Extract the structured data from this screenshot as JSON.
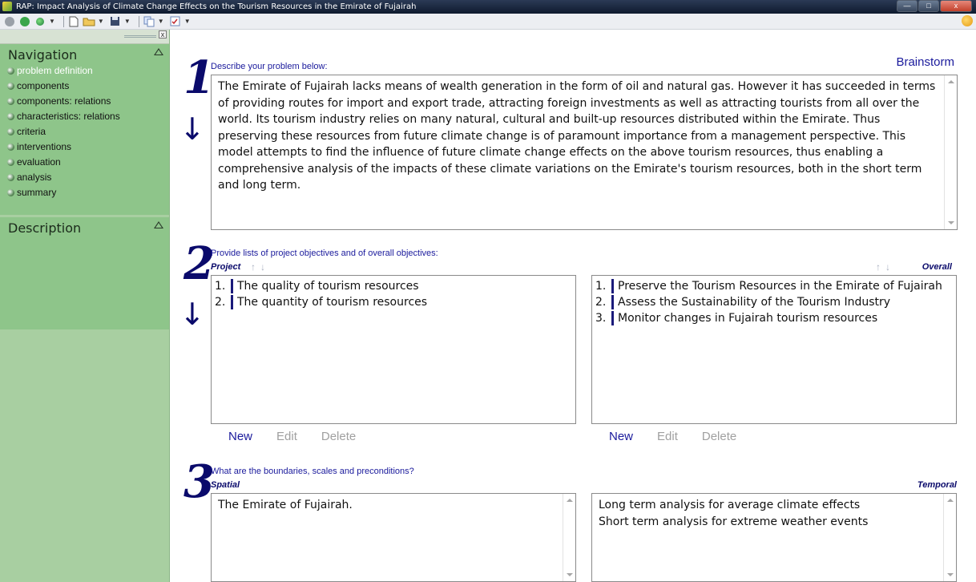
{
  "window": {
    "title": "RAP: Impact Analysis of Climate Change Effects on the Tourism Resources in the Emirate of Fujairah",
    "minimize": "—",
    "maximize": "□",
    "close": "x"
  },
  "toolbar": {
    "back_icon": "back-arrow-icon",
    "forward_icon": "forward-arrow-icon",
    "globe_icon": "globe-icon",
    "new_icon": "new-document-icon",
    "open_icon": "open-folder-icon",
    "save_icon": "save-disk-icon",
    "copy_icon": "copy-icon",
    "check_icon": "checklist-icon",
    "help_icon": "help-icon"
  },
  "sidebar": {
    "close_label": "x",
    "navigation": {
      "title": "Navigation",
      "items": [
        {
          "label": "problem definition",
          "active": true
        },
        {
          "label": "components"
        },
        {
          "label": "components: relations"
        },
        {
          "label": "characteristics: relations"
        },
        {
          "label": "criteria"
        },
        {
          "label": "interventions"
        },
        {
          "label": "evaluation"
        },
        {
          "label": "analysis"
        },
        {
          "label": "summary"
        }
      ]
    },
    "description": {
      "title": "Description"
    }
  },
  "main": {
    "step1": {
      "number": "1",
      "arrow": "↓",
      "prompt": "Describe your problem below:",
      "brainstorm": "Brainstorm",
      "text": "The Emirate of Fujairah lacks means of wealth generation in the form of oil and natural gas. However it has succeeded in terms of providing routes for import and export trade, attracting foreign investments as well as attracting tourists from all over the world. Its tourism industry relies on many natural, cultural and built-up resources distributed within the Emirate. Thus preserving these resources from future climate change is of paramount importance from a management perspective. This model attempts to find the influence of future climate change effects on the above tourism resources, thus enabling a comprehensive analysis of the impacts of these climate variations on the Emirate's tourism resources, both in the short term and long term."
    },
    "step2": {
      "number": "2",
      "arrow": "↓",
      "prompt": "Provide lists of project objectives and of overall objectives:",
      "project_label": "Project",
      "overall_label": "Overall",
      "sort_arrows": "↑↓",
      "project_items": [
        {
          "num": "1.",
          "text": "The quality of tourism resources"
        },
        {
          "num": "2.",
          "text": "The quantity of tourism resources"
        }
      ],
      "overall_items": [
        {
          "num": "1.",
          "text": "Preserve the Tourism Resources in the Emirate of Fujairah"
        },
        {
          "num": "2.",
          "text": "Assess the Sustainability of the Tourism Industry"
        },
        {
          "num": "3.",
          "text": "Monitor changes in Fujairah tourism resources"
        }
      ],
      "actions": {
        "new": "New",
        "edit": "Edit",
        "delete": "Delete"
      }
    },
    "step3": {
      "number": "3",
      "prompt": "What are the boundaries, scales and preconditions?",
      "spatial_label": "Spatial",
      "temporal_label": "Temporal",
      "spatial_text": "The Emirate of Fujairah.",
      "temporal_lines": [
        "Long term analysis for average climate effects",
        "Short term analysis for extreme weather events"
      ]
    }
  }
}
